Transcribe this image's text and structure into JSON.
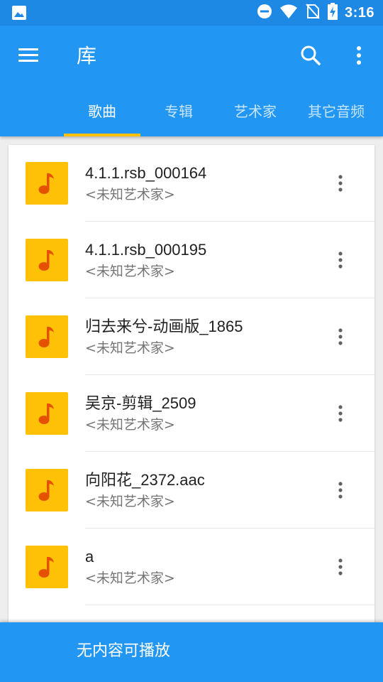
{
  "status_bar": {
    "time": "3:16",
    "icons": [
      "image-icon",
      "dnd-icon",
      "wifi-icon",
      "no-sim-icon",
      "battery-charging-icon"
    ]
  },
  "toolbar": {
    "title": "库",
    "icons": {
      "menu": "menu-icon",
      "search": "search-icon",
      "more": "more-vert-icon"
    }
  },
  "tabs": [
    {
      "label": "歌曲",
      "active": true
    },
    {
      "label": "专辑",
      "active": false
    },
    {
      "label": "艺术家",
      "active": false
    },
    {
      "label": "其它音频",
      "active": false
    }
  ],
  "songs": [
    {
      "title": "4.1.1.rsb_000164",
      "artist": "<未知艺术家>"
    },
    {
      "title": "4.1.1.rsb_000195",
      "artist": "<未知艺术家>"
    },
    {
      "title": "归去来兮-动画版_1865",
      "artist": "<未知艺术家>"
    },
    {
      "title": "吴京-剪辑_2509",
      "artist": "<未知艺术家>"
    },
    {
      "title": "向阳花_2372.aac",
      "artist": "<未知艺术家>"
    },
    {
      "title": "a",
      "artist": "<未知艺术家>"
    }
  ],
  "bottom_bar": {
    "text": "无内容可播放"
  },
  "colors": {
    "status_bar": "#1e88e5",
    "primary": "#2196f3",
    "accent": "#ffc107",
    "note_icon": "#e65100"
  }
}
